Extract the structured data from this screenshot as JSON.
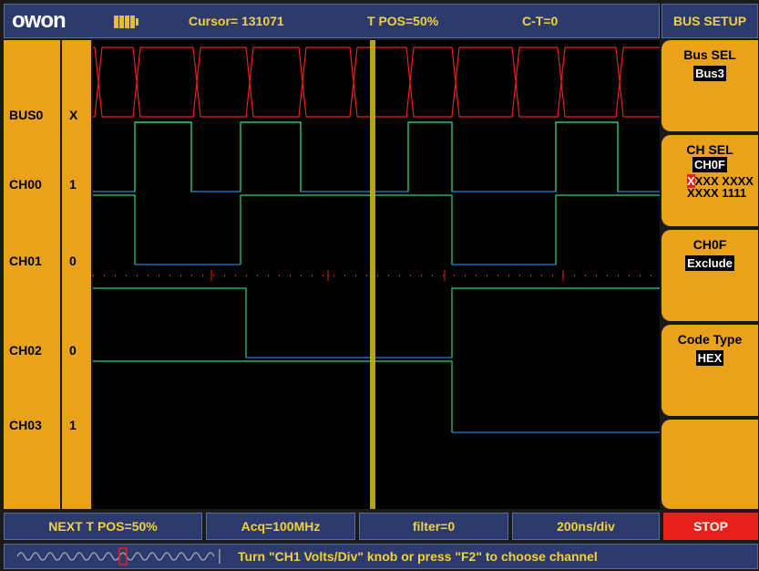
{
  "header": {
    "logo": "owon",
    "cursor": "Cursor= 131071",
    "tpos": "T POS=50%",
    "ct": "C-T=0",
    "panel_title": "BUS SETUP"
  },
  "channels": [
    {
      "label": "BUS0",
      "value": "X"
    },
    {
      "label": "CH00",
      "value": "1"
    },
    {
      "label": "CH01",
      "value": "0"
    },
    {
      "label": "CH02",
      "value": "0"
    },
    {
      "label": "CH03",
      "value": "1"
    }
  ],
  "menu": {
    "bus_sel": {
      "title": "Bus SEL",
      "value": "Bus3"
    },
    "ch_sel": {
      "title": "CH SEL",
      "value": "CH0F",
      "bits_highlight": "X",
      "bits_line1_rest": "XXX XXXX",
      "bits_line2": "XXXX 1111"
    },
    "ch_mode": {
      "title": "CH0F",
      "value": "Exclude"
    },
    "code_type": {
      "title": "Code Type",
      "value": "HEX"
    }
  },
  "bottom": {
    "next_tpos": "NEXT T POS=50%",
    "acq": "Acq=100MHz",
    "filter": "filter=0",
    "timebase": "200ns/div",
    "stop": "STOP"
  },
  "status": {
    "hint": "Turn \"CH1 Volts/Div\" knob or press \"F2\" to choose channel"
  },
  "colors": {
    "bus": "#e8201a",
    "high": "#2dd36f",
    "low": "#2d7fd3",
    "trigger_marker": "#c8b41e",
    "panel": "#e9a21a",
    "bar": "#2d3a6e"
  }
}
